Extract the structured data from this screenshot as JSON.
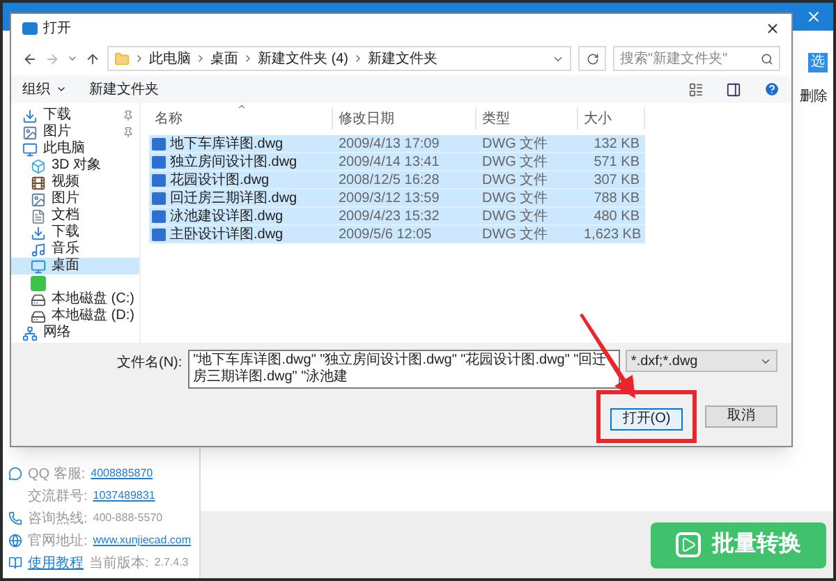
{
  "app": {
    "side_button": "选",
    "side_action": "删除",
    "contacts": [
      {
        "kind": "qq",
        "label": "QQ 客服:",
        "value": "4008885870",
        "link": true
      },
      {
        "kind": "none",
        "label": "交流群号:",
        "value": "1037489831",
        "link": true
      },
      {
        "kind": "phone",
        "label": "咨询热线:",
        "value": "400-888-5570",
        "link": false
      },
      {
        "kind": "web",
        "label": "官网地址:",
        "value": "www.xunjiecad.com",
        "link": true
      }
    ],
    "tutorial": {
      "link": "使用教程",
      "version_label": "当前版本:",
      "version": "2.7.4.3"
    },
    "convert_button": "批量转换"
  },
  "dialog": {
    "title": "打开",
    "breadcrumb": [
      "此电脑",
      "桌面",
      "新建文件夹 (4)",
      "新建文件夹"
    ],
    "search": {
      "placeholder": "搜索\"新建文件夹\""
    },
    "toolbar": [
      {
        "label": "组织",
        "dropdown": true
      },
      {
        "label": "新建文件夹",
        "dropdown": false
      }
    ],
    "nav": [
      {
        "label": "下载",
        "kind": "download",
        "pinned": true,
        "selected": false
      },
      {
        "label": "图片",
        "kind": "pictures",
        "pinned": true,
        "selected": false
      },
      {
        "label": "此电脑",
        "kind": "pc",
        "pinned": false,
        "selected": false,
        "children": [
          {
            "label": "3D 对象",
            "kind": "object3d",
            "pinned": false,
            "selected": false
          },
          {
            "label": "视频",
            "kind": "video",
            "pinned": false,
            "selected": false
          },
          {
            "label": "图片",
            "kind": "pictures",
            "pinned": false,
            "selected": false
          },
          {
            "label": "文档",
            "kind": "docs",
            "pinned": false,
            "selected": false
          },
          {
            "label": "下载",
            "kind": "download",
            "pinned": false,
            "selected": false
          },
          {
            "label": "音乐",
            "kind": "music",
            "pinned": false,
            "selected": false
          },
          {
            "label": "桌面",
            "kind": "desktop",
            "pinned": false,
            "selected": true
          },
          {
            "kind": "app",
            "pinned": false,
            "selected": false
          },
          {
            "label": "本地磁盘 (C:)",
            "kind": "drive-c",
            "pinned": false,
            "selected": false
          },
          {
            "label": "本地磁盘 (D:)",
            "kind": "drive",
            "pinned": false,
            "selected": false
          }
        ]
      },
      {
        "label": "网络",
        "kind": "network",
        "pinned": false,
        "selected": false
      }
    ],
    "columns": [
      {
        "label": "名称",
        "sorted": true
      },
      {
        "label": "修改日期",
        "sorted": false
      },
      {
        "label": "类型",
        "sorted": false
      },
      {
        "label": "大小",
        "sorted": false
      }
    ],
    "files": [
      {
        "name": "地下车库详图.dwg",
        "modified": "2009/4/13 17:09",
        "type": "DWG 文件",
        "size": "132 KB",
        "selected": true
      },
      {
        "name": "独立房间设计图.dwg",
        "modified": "2009/4/14 13:41",
        "type": "DWG 文件",
        "size": "571 KB",
        "selected": true
      },
      {
        "name": "花园设计图.dwg",
        "modified": "2008/12/5 16:28",
        "type": "DWG 文件",
        "size": "307 KB",
        "selected": true
      },
      {
        "name": "回迁房三期详图.dwg",
        "modified": "2009/3/12 13:59",
        "type": "DWG 文件",
        "size": "788 KB",
        "selected": true
      },
      {
        "name": "泳池建设详图.dwg",
        "modified": "2009/4/23 15:32",
        "type": "DWG 文件",
        "size": "480 KB",
        "selected": true
      },
      {
        "name": "主卧设计详图.dwg",
        "modified": "2009/5/6 12:05",
        "type": "DWG 文件",
        "size": "1,623 KB",
        "selected": true
      }
    ],
    "filename_label": "文件名(N):",
    "filename": "\"地下车库详图.dwg\" \"独立房间设计图.dwg\" \"花园设计图.dwg\" \"回迁房三期详图.dwg\" \"泳池建",
    "filter": "*.dxf;*.dwg",
    "buttons": [
      {
        "label": "打开(O)",
        "kind": "primary",
        "highlighted": true
      },
      {
        "label": "取消",
        "kind": "secondary",
        "highlighted": false
      }
    ]
  }
}
